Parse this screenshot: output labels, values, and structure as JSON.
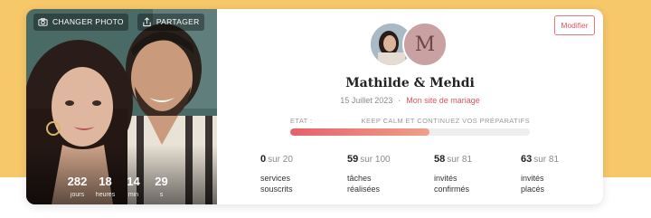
{
  "photo": {
    "change_photo_label": "CHANGER PHOTO",
    "share_label": "PARTAGER",
    "countdown": [
      {
        "value": "282",
        "label": "jours"
      },
      {
        "value": "18",
        "label": "heures"
      },
      {
        "value": "14",
        "label": "min"
      },
      {
        "value": "29",
        "label": "s"
      }
    ]
  },
  "header": {
    "modify_label": "Modifier",
    "avatar_letter": "M",
    "names": "Mathilde & Mehdi",
    "date": "15 Juillet 2023",
    "separator": "·",
    "site_link": "Mon site de mariage"
  },
  "status": {
    "label": "ETAT :",
    "message": "KEEP CALM ET CONTINUEZ VOS PRÉPARATIFS",
    "progress": 0.58
  },
  "stats": [
    {
      "value": "0",
      "of": "sur 20",
      "line1": "services",
      "line2": "souscrits"
    },
    {
      "value": "59",
      "of": "sur 100",
      "line1": "tâches",
      "line2": "réalisées"
    },
    {
      "value": "58",
      "of": "sur 81",
      "line1": "invités",
      "line2": "confirmés"
    },
    {
      "value": "63",
      "of": "sur 81",
      "line1": "invités",
      "line2": "placés"
    }
  ],
  "colors": {
    "accent": "#e2555a",
    "background_band": "#f7c86a",
    "avatar_letter_bg": "#c9a1a3"
  }
}
